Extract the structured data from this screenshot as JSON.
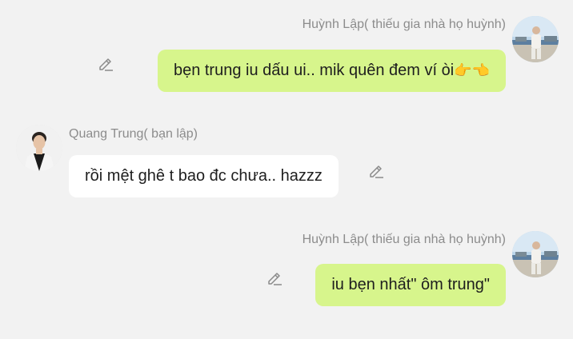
{
  "messages": [
    {
      "sender": "Huỳnh Lập( thiếu gia nhà họ huỳnh)",
      "text": "bẹn trung iu dấu ui.. mik quên đem ví òi",
      "emoji": "👉👈",
      "side": "right",
      "avatar_icon": "beach-photo-avatar"
    },
    {
      "sender": "Quang Trung( bạn lập)",
      "text": "rồi mệt ghê t bao đc chưa.. hazzz",
      "side": "left",
      "avatar_icon": "portrait-photo-avatar"
    },
    {
      "sender": "Huỳnh Lập( thiếu gia nhà họ huỳnh)",
      "text": "iu bẹn nhất\" ôm trung\"",
      "side": "right",
      "avatar_icon": "beach-photo-avatar"
    }
  ],
  "colors": {
    "background": "#f2f2f2",
    "own_bubble": "#d7f58c",
    "other_bubble": "#ffffff",
    "sender_name": "#8c8c8c"
  },
  "icons": {
    "edit": "pencil-edit-icon"
  }
}
